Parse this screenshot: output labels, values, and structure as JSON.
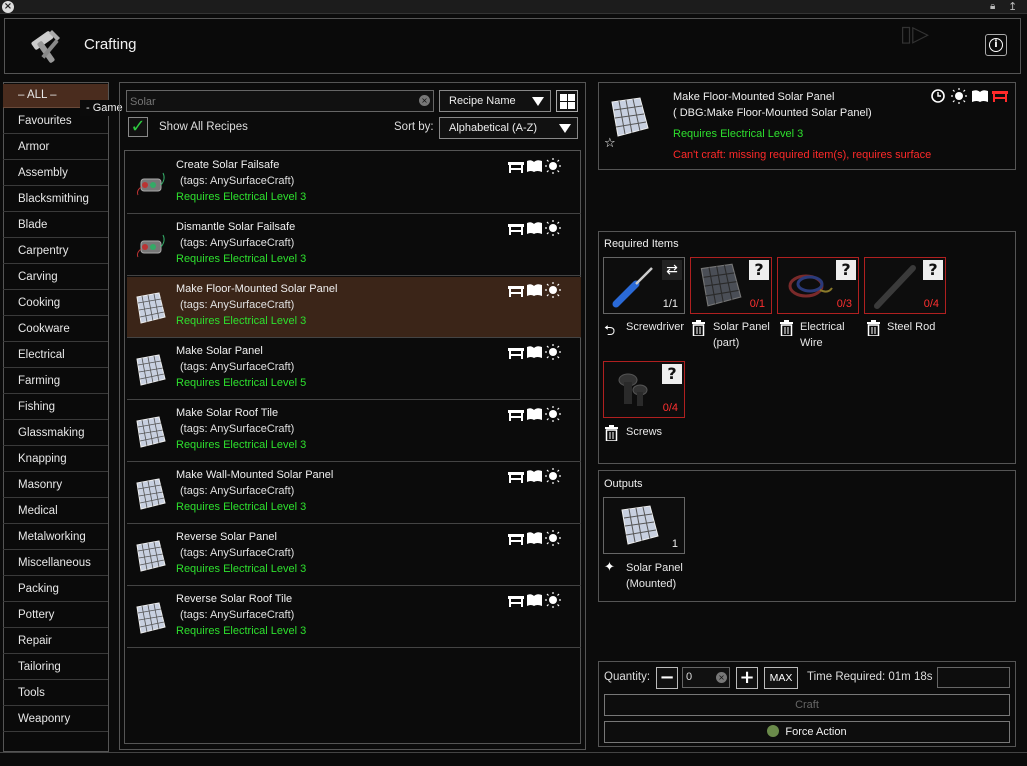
{
  "window": {
    "title": "Crafting",
    "paused_label": "- Game Paused -"
  },
  "sidebar": {
    "items": [
      {
        "label": "– ALL –",
        "active": true
      },
      {
        "label": "Favourites"
      },
      {
        "label": "Armor"
      },
      {
        "label": "Assembly"
      },
      {
        "label": "Blacksmithing"
      },
      {
        "label": "Blade"
      },
      {
        "label": "Carpentry"
      },
      {
        "label": "Carving"
      },
      {
        "label": "Cooking"
      },
      {
        "label": "Cookware"
      },
      {
        "label": "Electrical"
      },
      {
        "label": "Farming"
      },
      {
        "label": "Fishing"
      },
      {
        "label": "Glassmaking"
      },
      {
        "label": "Knapping"
      },
      {
        "label": "Masonry"
      },
      {
        "label": "Medical"
      },
      {
        "label": "Metalworking"
      },
      {
        "label": "Miscellaneous"
      },
      {
        "label": "Packing"
      },
      {
        "label": "Pottery"
      },
      {
        "label": "Repair"
      },
      {
        "label": "Tailoring"
      },
      {
        "label": "Tools"
      },
      {
        "label": "Weaponry"
      }
    ]
  },
  "search": {
    "value": "",
    "placeholder": "Solar"
  },
  "filter": {
    "search_by": "Recipe Name",
    "show_all_label": "Show All Recipes",
    "show_all_checked": true,
    "sort_by_label": "Sort by:",
    "sort_value": "Alphabetical (A-Z)"
  },
  "recipes": [
    {
      "name": "Create Solar Failsafe",
      "tags": "(tags: AnySurfaceCraft)",
      "req": "Requires Electrical Level 3",
      "icon": "failsafe-icon"
    },
    {
      "name": "Dismantle Solar Failsafe",
      "tags": "(tags: AnySurfaceCraft)",
      "req": "Requires Electrical Level 3",
      "icon": "failsafe-icon"
    },
    {
      "name": "Make Floor-Mounted Solar Panel",
      "tags": "(tags: AnySurfaceCraft)",
      "req": "Requires Electrical Level 3",
      "icon": "solar-panel-icon",
      "selected": true
    },
    {
      "name": "Make Solar Panel",
      "tags": "(tags: AnySurfaceCraft)",
      "req": "Requires Electrical Level 5",
      "icon": "solar-panel-icon"
    },
    {
      "name": "Make Solar Roof Tile",
      "tags": "(tags: AnySurfaceCraft)",
      "req": "Requires Electrical Level 3",
      "icon": "solar-panel-icon"
    },
    {
      "name": "Make Wall-Mounted Solar Panel",
      "tags": "(tags: AnySurfaceCraft)",
      "req": "Requires Electrical Level 3",
      "icon": "solar-panel-icon"
    },
    {
      "name": "Reverse Solar Panel",
      "tags": "(tags: AnySurfaceCraft)",
      "req": "Requires Electrical Level 3",
      "icon": "solar-panel-icon"
    },
    {
      "name": "Reverse Solar Roof Tile",
      "tags": "(tags: AnySurfaceCraft)",
      "req": "Requires Electrical Level 3",
      "icon": "solar-panel-icon"
    }
  ],
  "detail": {
    "name": "Make Floor-Mounted Solar Panel",
    "debug": "( DBG:Make Floor-Mounted Solar Panel)",
    "requirement": "Requires Electrical Level 3",
    "error": "Can't craft: missing required item(s), requires surface"
  },
  "required": {
    "title": "Required Items",
    "items": [
      {
        "label": "Screwdriver",
        "count": "1/1",
        "missing": false,
        "icon": "screwdriver-icon",
        "action_icon": "keep-icon"
      },
      {
        "label": "Solar Panel (part)",
        "count": "0/1",
        "missing": true,
        "icon": "solar-panel-icon",
        "action_icon": "trash-icon"
      },
      {
        "label": "Electrical Wire",
        "count": "0/3",
        "missing": true,
        "icon": "wire-icon",
        "action_icon": "trash-icon"
      },
      {
        "label": "Steel Rod",
        "count": "0/4",
        "missing": true,
        "icon": "rod-icon",
        "action_icon": "trash-icon"
      },
      {
        "label": "Screws",
        "count": "0/4",
        "missing": true,
        "icon": "screws-icon",
        "action_icon": "trash-icon"
      }
    ]
  },
  "outputs": {
    "title": "Outputs",
    "items": [
      {
        "label": "Solar Panel (Mounted)",
        "count": "1",
        "icon": "solar-panel-icon"
      }
    ]
  },
  "quantity": {
    "label": "Quantity:",
    "value": "0",
    "max_label": "MAX",
    "time_label": "Time Required: 01m 18s"
  },
  "buttons": {
    "craft": "Craft",
    "force": "Force Action"
  },
  "colors": {
    "accent_selected": "#3b2518",
    "requirement": "#2ee02e",
    "error": "#ff2a2a"
  }
}
